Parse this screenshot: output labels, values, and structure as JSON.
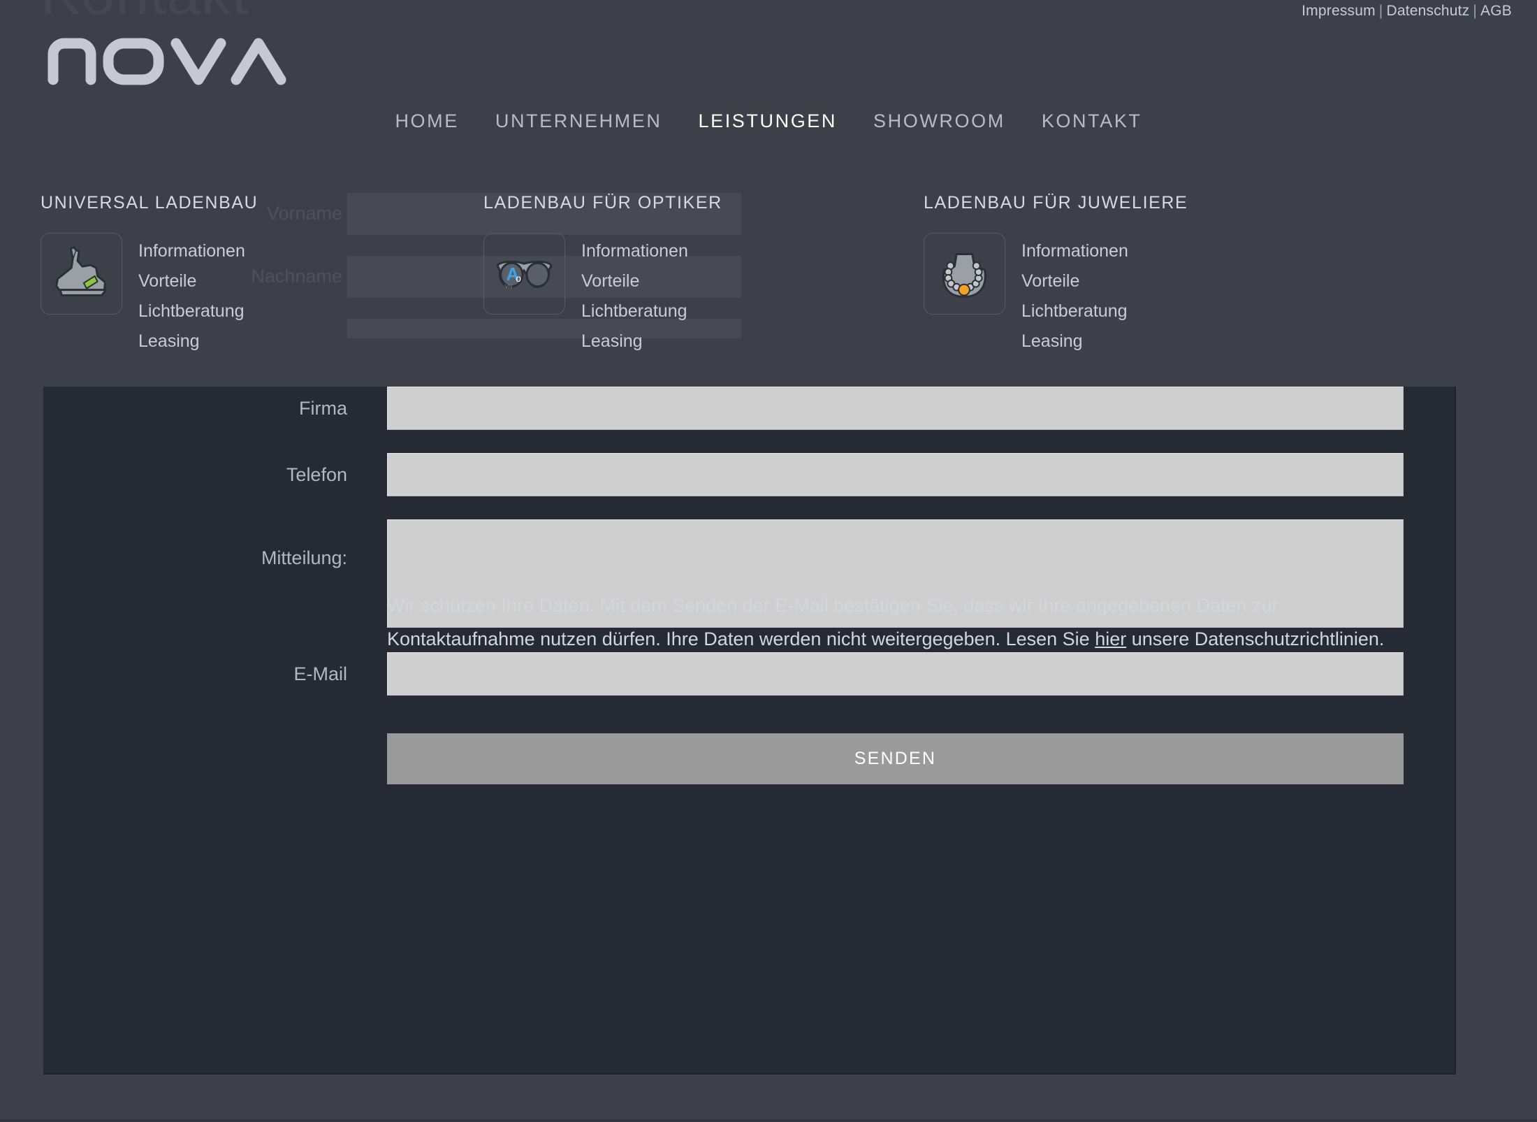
{
  "page": {
    "ghost_title": "Kontakt",
    "background_color": "#3d4049",
    "panel_color": "#262a35"
  },
  "utility": {
    "impressum": "Impressum",
    "datenschutz": "Datenschutz",
    "agb": "AGB",
    "separator": "|"
  },
  "brand": {
    "name": "nova",
    "logo_icon": "nova-wordmark"
  },
  "nav": {
    "items": [
      {
        "label": "HOME",
        "active": false
      },
      {
        "label": "UNTERNEHMEN",
        "active": false
      },
      {
        "label": "LEISTUNGEN",
        "active": true
      },
      {
        "label": "SHOWROOM",
        "active": false
      },
      {
        "label": "KONTAKT",
        "active": false
      }
    ]
  },
  "services": {
    "columns": [
      {
        "heading": "UNIVERSAL LADENBAU",
        "icon": "sneaker-icon",
        "icon_accent": "#8cc63f",
        "links": [
          "Informationen",
          "Vorteile",
          "Lichtberatung",
          "Leasing"
        ]
      },
      {
        "heading": "LADENBAU FÜR OPTIKER",
        "icon": "eyeglasses-icon",
        "icon_accent": "#3ba5e8",
        "links": [
          "Informationen",
          "Vorteile",
          "Lichtberatung",
          "Leasing"
        ]
      },
      {
        "heading": "LADENBAU FÜR JUWELIERE",
        "icon": "necklace-icon",
        "icon_accent": "#f5a021",
        "links": [
          "Informationen",
          "Vorteile",
          "Lichtberatung",
          "Leasing"
        ]
      }
    ]
  },
  "ghost_form": {
    "fields": [
      {
        "label": "Vorname"
      },
      {
        "label": "Nachname"
      }
    ]
  },
  "contact_form": {
    "fields": [
      {
        "label": "Firma",
        "value": "",
        "placeholder": "",
        "type": "text"
      },
      {
        "label": "Telefon",
        "value": "",
        "placeholder": "",
        "type": "text"
      },
      {
        "label": "Mitteilung:",
        "value": "",
        "placeholder": "",
        "type": "textarea"
      },
      {
        "label": "E-Mail",
        "value": "",
        "placeholder": "",
        "type": "text"
      }
    ],
    "privacy": {
      "part1": "Wir schützen Ihre Daten. Mit dem Senden der E-Mail bestätigen Sie, dass wir Ihre angegebenen Daten zur Kontaktaufnahme nutzen dürfen. Ihre Daten werden nicht weitergegeben. Lesen Sie ",
      "link": "hier",
      "part2": " unsere Datenschutzrichtlinien."
    },
    "submit_label": "SENDEN"
  }
}
